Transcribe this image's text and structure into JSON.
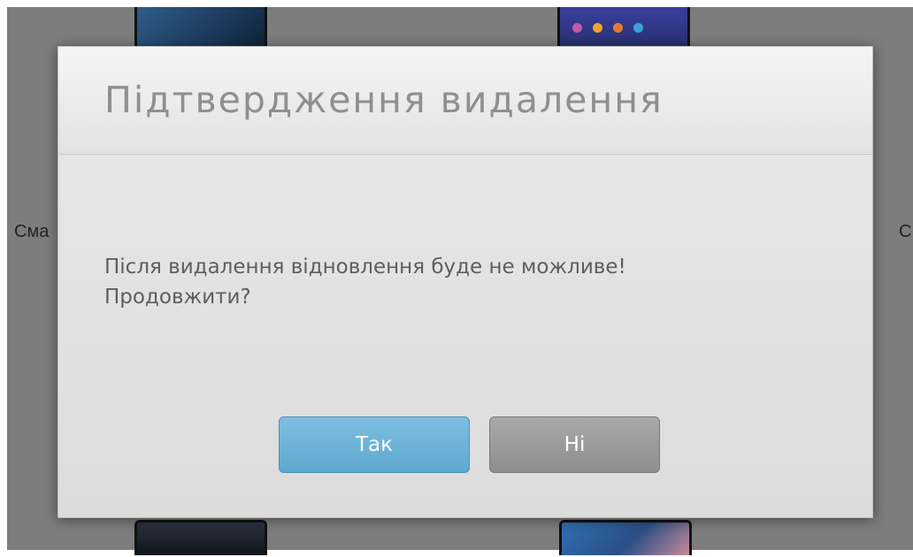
{
  "background": {
    "left_label": "Сма",
    "right_label": "С",
    "overlay_color": "#7d7d7d",
    "app_dot_colors": [
      "#c05aa8",
      "#f0a531",
      "#e8783a",
      "#3aa0d8"
    ]
  },
  "dialog": {
    "title": "Підтвердження видалення",
    "message_line1": "Після видалення відновлення буде не можливе!",
    "message_line2": "Продовжити?",
    "confirm_label": "Так",
    "cancel_label": "Ні",
    "confirm_color": "#6bb3d8",
    "cancel_color": "#9a9a9a"
  }
}
